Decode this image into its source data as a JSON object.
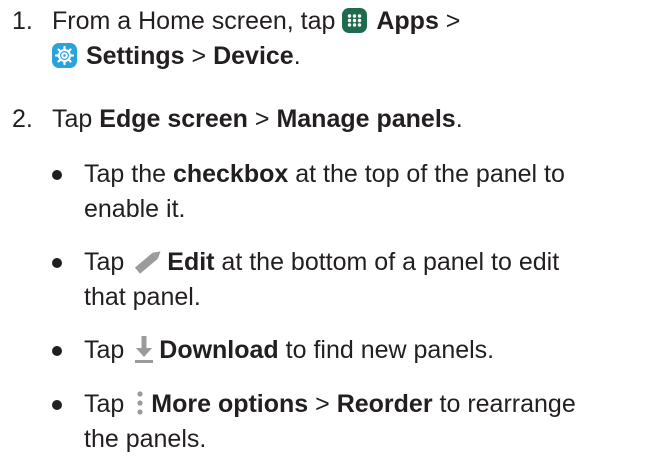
{
  "steps": [
    {
      "number": "1.",
      "line1_pre": "From a Home screen, tap ",
      "apps_label": "Apps",
      "sep1": " >",
      "settings_label": "Settings",
      "sep2": " > ",
      "device_label": "Device",
      "end": ".",
      "icons": [
        "apps-icon",
        "settings-icon"
      ]
    },
    {
      "number": "2.",
      "pre": "Tap ",
      "edge_label": "Edge screen",
      "sep": " > ",
      "manage_label": "Manage panels",
      "end": "."
    }
  ],
  "bullets": [
    {
      "pre": "Tap the ",
      "bold": "checkbox",
      "line1_post": " at the top of the panel to",
      "line2": "enable it."
    },
    {
      "pre": "Tap ",
      "icon": "pencil-icon",
      "bold": "Edit",
      "line1_post": " at the bottom of a panel to edit",
      "line2": "that panel."
    },
    {
      "pre": "Tap ",
      "icon": "download-icon",
      "bold": "Download",
      "post": " to find new panels."
    },
    {
      "pre": "Tap ",
      "icon": "more-options-icon",
      "bold": "More options",
      "sep": " > ",
      "bold2": "Reorder",
      "line1_post": " to rearrange",
      "line2": "the panels."
    }
  ],
  "colors": {
    "text": "#231f20",
    "apps_icon": "#1f6b4e",
    "settings_icon": "#29a3d9",
    "glyph_gray": "#9b9b9b"
  }
}
